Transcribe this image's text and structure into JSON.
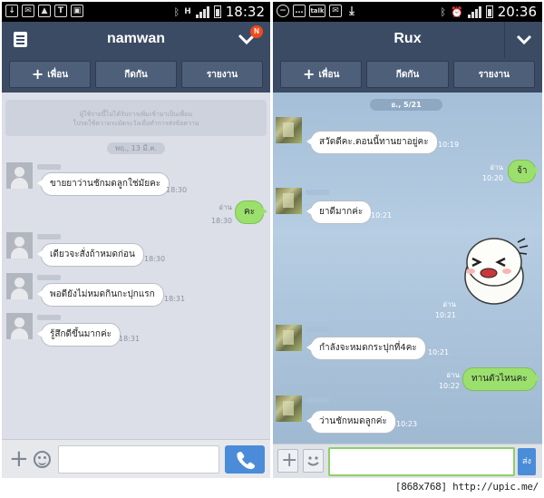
{
  "left_screen": {
    "status_bar": {
      "time": "18:32",
      "network_label": "H",
      "icons": [
        "download-icon",
        "mail-icon",
        "gallery-icon",
        "text-icon",
        "bag-icon",
        "bluetooth-icon",
        "signal-icon",
        "battery-icon"
      ]
    },
    "header": {
      "title": "namwan",
      "badge": "N"
    },
    "actions": [
      {
        "label": "เพื่อน",
        "icon": "plus-icon"
      },
      {
        "label": "กีดกัน"
      },
      {
        "label": "รายงาน"
      }
    ],
    "notice_line1": "ผู้ใช้รายนี้ไม่ได้รับการเพิ่มเข้ามาเป็นเพื่อน",
    "notice_line2": "โปรดใช้ความระมัดระวังเมื่อทำการส่งข้อความ",
    "date_label": "พฤ., 13 มี.ค.",
    "messages": [
      {
        "side": "in",
        "text": "ขายยาว่านชักมดลูกใช่มัยคะ",
        "time": "18:30"
      },
      {
        "side": "out",
        "text": "คะ",
        "read": "อ่าน",
        "time": "18:30"
      },
      {
        "side": "in",
        "text": "เดียวจะสั่งถ้าหมดก่อน",
        "time": "18:30"
      },
      {
        "side": "in",
        "text": "พอดียังไม่หมดกินกะปุกแรก",
        "time": "18:31"
      },
      {
        "side": "in",
        "text": "รู้สึกดีขึ้นมากค่ะ",
        "time": "18:31"
      }
    ]
  },
  "right_screen": {
    "status_bar": {
      "time": "20:36",
      "icons": [
        "minus-circle-icon",
        "chat-icon",
        "talk-icon",
        "mail-icon",
        "download-icon",
        "bluetooth-icon",
        "alarm-icon",
        "signal-icon",
        "battery-icon"
      ]
    },
    "header": {
      "title": "Rux"
    },
    "actions": [
      {
        "label": "เพื่อน",
        "icon": "plus-icon"
      },
      {
        "label": "กีดกัน"
      },
      {
        "label": "รายงาน"
      }
    ],
    "date_label": "อ., 5/21",
    "messages": [
      {
        "side": "in",
        "text": "สวัดดีคะ.ตอนนี้ทานยาอยู่คะ",
        "time": "10:19"
      },
      {
        "side": "out",
        "text": "จ้า",
        "read": "อ่าน",
        "time": "10:20"
      },
      {
        "side": "in",
        "text": "ยาดีมากค่ะ",
        "time": "10:21"
      },
      {
        "side": "out",
        "sticker": "laughing-sticker",
        "read": "อ่าน",
        "time": "10:21"
      },
      {
        "side": "in",
        "text": "กำลังจะหมดกระปุกที่4คะ",
        "time": "10:21"
      },
      {
        "side": "out",
        "text": "ทานตัวไหนคะ",
        "read": "อ่าน",
        "time": "10:22"
      },
      {
        "side": "in",
        "text": "ว่านชักหมดลูกค่ะ",
        "time": "10:23"
      }
    ],
    "send_label": "ส่ง"
  },
  "watermark": "[868x768] http://upic.me/",
  "colors": {
    "header": "#3b4b63",
    "bubble_out": "#9be06d",
    "call_button": "#4a8cd8",
    "badge": "#f04a1c"
  }
}
